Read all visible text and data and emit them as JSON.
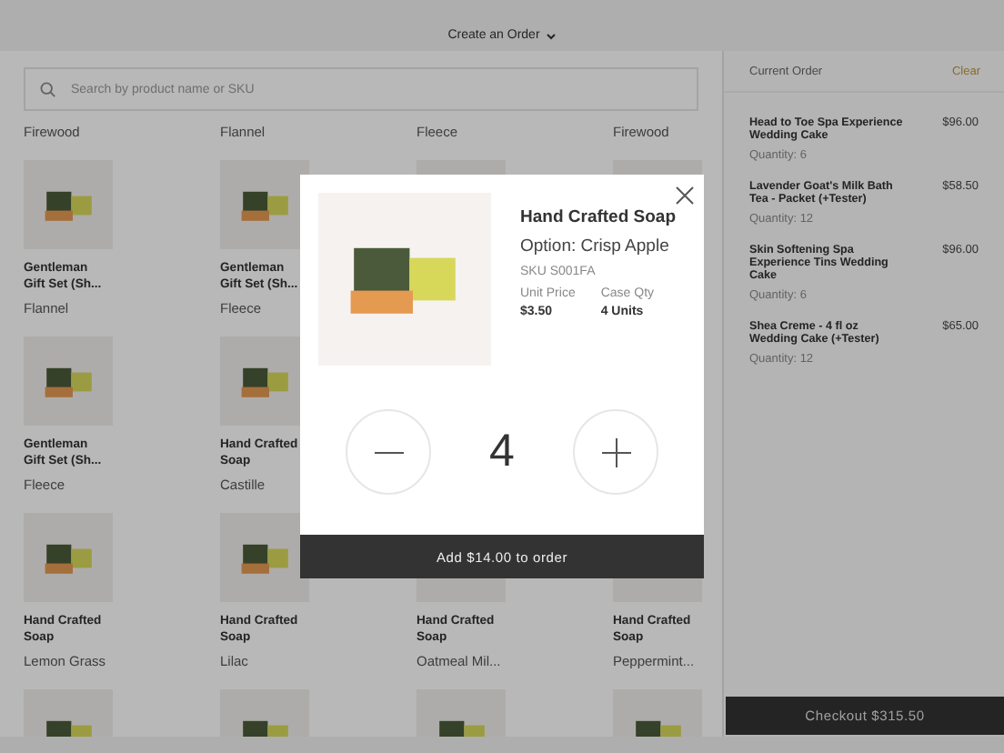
{
  "header": {
    "title": "Create an Order"
  },
  "search": {
    "placeholder": "Search by product name or SKU"
  },
  "cut_labels": [
    "Firewood",
    "Flannel",
    "Fleece",
    "Firewood"
  ],
  "products": [
    {
      "kind": "card",
      "name": "Gentleman Gift Set (Sh...",
      "option": "Flannel"
    },
    {
      "kind": "card",
      "name": "Gentleman Gift Set (Sh...",
      "option": "Fleece"
    },
    {
      "kind": "photo"
    },
    {
      "kind": "photo"
    },
    {
      "kind": "card",
      "name": "Gentleman Gift Set (Sh...",
      "option": "Fleece"
    },
    {
      "kind": "card",
      "name": "Hand Crafted Soap",
      "option": "Castille"
    },
    {
      "kind": "photo"
    },
    {
      "kind": "photo"
    },
    {
      "kind": "card",
      "name": "Hand Crafted Soap",
      "option": "Lemon Grass"
    },
    {
      "kind": "card",
      "name": "Hand Crafted Soap",
      "option": "Lilac"
    },
    {
      "kind": "card",
      "name": "Hand Crafted Soap",
      "option": "Oatmeal Mil..."
    },
    {
      "kind": "card",
      "name": "Hand Crafted Soap",
      "option": "Peppermint..."
    },
    {
      "kind": "photo"
    },
    {
      "kind": "photo"
    },
    {
      "kind": "photo"
    },
    {
      "kind": "photo"
    }
  ],
  "order": {
    "title": "Current Order",
    "clear": "Clear",
    "items": [
      {
        "name": "Head to Toe Spa Experience Wedding Cake",
        "price": "$96.00",
        "quantity": "Quantity: 6"
      },
      {
        "name": "Lavender Goat's Milk Bath Tea - Packet (+Tester)",
        "price": "$58.50",
        "quantity": "Quantity: 12"
      },
      {
        "name": "Skin Softening Spa Experience Tins Wedding Cake",
        "price": "$96.00",
        "quantity": "Quantity: 6"
      },
      {
        "name": "Shea Creme - 4 fl oz Wedding Cake (+Tester)",
        "price": "$65.00",
        "quantity": "Quantity: 12"
      }
    ],
    "checkout": "Checkout $315.50"
  },
  "modal": {
    "name": "Hand Crafted Soap",
    "option": "Option: Crisp Apple",
    "sku": "SKU S001FA",
    "unit_price_label": "Unit Price",
    "unit_price": "$3.50",
    "case_label": "Case Qty",
    "case_qty": "4 Units",
    "quantity": "4",
    "add_button": "Add $14.00 to order"
  }
}
